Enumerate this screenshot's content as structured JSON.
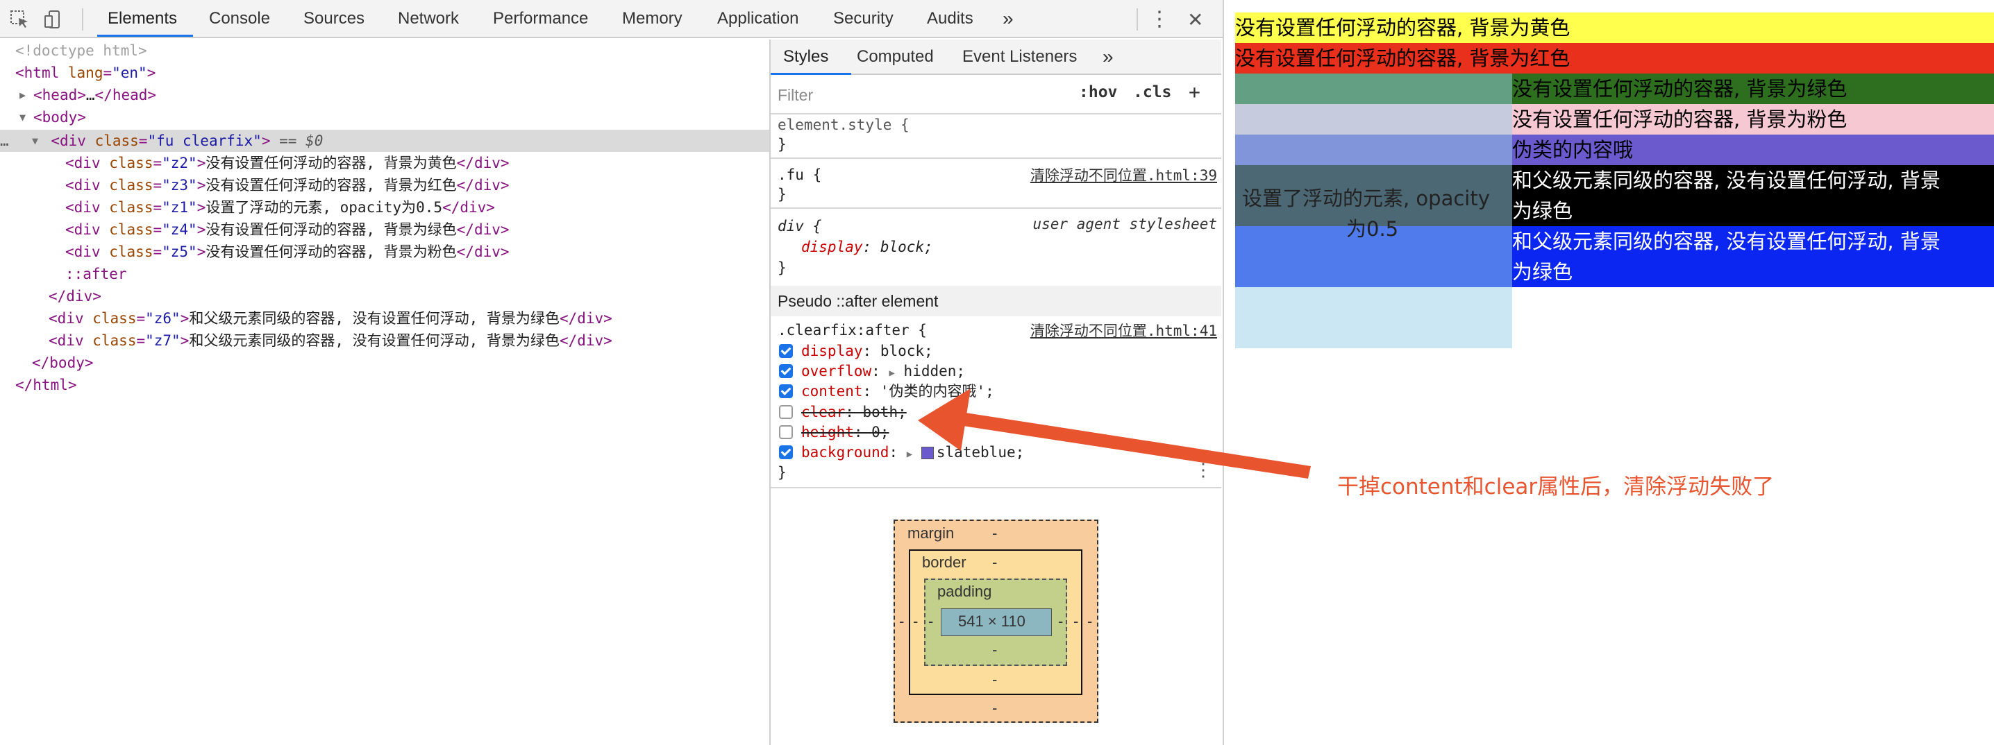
{
  "toolbar": {
    "tabs": [
      "Elements",
      "Console",
      "Sources",
      "Network",
      "Performance",
      "Memory",
      "Application",
      "Security",
      "Audits"
    ],
    "more": "»",
    "menu": "⋮",
    "close": "✕"
  },
  "dom": {
    "doctype": "<!doctype html>",
    "html_open_tag": "html",
    "html_attr": "lang",
    "html_attr_val": "\"en\"",
    "head": "head",
    "head_close": "</head>",
    "ellipsis": "…",
    "body": "body",
    "div_tag": "div",
    "class_attr": "class",
    "selected_class": "\"fu clearfix\"",
    "selected_suffix": "== $0",
    "row_dots": "…",
    "children": [
      {
        "cls": "\"z2\"",
        "text": "没有设置任何浮动的容器, 背景为黄色"
      },
      {
        "cls": "\"z3\"",
        "text": "没有设置任何浮动的容器, 背景为红色"
      },
      {
        "cls": "\"z1\"",
        "text": "设置了浮动的元素, opacity为0.5"
      },
      {
        "cls": "\"z4\"",
        "text": "没有设置任何浮动的容器, 背景为绿色"
      },
      {
        "cls": "\"z5\"",
        "text": "没有设置任何浮动的容器, 背景为粉色"
      }
    ],
    "after": "::after",
    "div_close": "</div>",
    "siblings": [
      {
        "cls": "\"z6\"",
        "text": "和父级元素同级的容器, 没有设置任何浮动, 背景为绿色"
      },
      {
        "cls": "\"z7\"",
        "text": "和父级元素同级的容器, 没有设置任何浮动, 背景为绿色"
      }
    ],
    "body_close": "</body>",
    "html_close": "</html>"
  },
  "styles": {
    "tabs": [
      "Styles",
      "Computed",
      "Event Listeners",
      "»"
    ],
    "filter_placeholder": "Filter",
    "hov": ":hov",
    "cls": ".cls",
    "plus": "+",
    "element_style": "element.style {",
    "close_brace": "}",
    "fu_selector": ".fu {",
    "fu_source": "清除浮动不同位置.html:39",
    "div_selector": "div {",
    "ua_label": "user agent stylesheet",
    "div_display_prop": "display",
    "div_display_val": "block;",
    "pseudo_header": "Pseudo ::after element",
    "clearfix_selector": ".clearfix:after {",
    "clearfix_source": "清除浮动不同位置.html:41",
    "props": [
      {
        "name": "display",
        "value": "block;",
        "checked": true
      },
      {
        "name": "overflow",
        "value": "hidden;",
        "checked": true
      },
      {
        "name": "content",
        "value": "'伪类的内容哦';",
        "checked": true
      },
      {
        "name": "clear",
        "value": "both;",
        "checked": false
      },
      {
        "name": "height",
        "value": "0;",
        "checked": false
      },
      {
        "name": "background",
        "value": "slateblue;",
        "checked": true
      }
    ],
    "kebab": "⋮"
  },
  "box_model": {
    "margin_label": "margin",
    "border_label": "border",
    "padding_label": "padding",
    "content_size": "541 × 110",
    "dash": "-"
  },
  "preview": {
    "yellow_text": "没有设置任何浮动的容器, 背景为黄色",
    "red_text": "没有设置任何浮动的容器, 背景为红色",
    "green_text": "没有设置任何浮动的容器, 背景为绿色",
    "pink_text": "没有设置任何浮动的容器, 背景为粉色",
    "pseudo_text": "伪类的内容哦",
    "float_line1": "设置了浮动的元素, opacity",
    "float_line2": "为0.5",
    "z6_line1": "和父级元素同级的容器, 没有设置任何浮动, 背景",
    "z6_line2": "为绿色",
    "z7_line1": "和父级元素同级的容器, 没有设置任何浮动, 背景",
    "z7_line2": "为绿色"
  },
  "annotation": "干掉content和clear属性后，清除浮动失败了",
  "colors": {
    "accent": "#1a73e8",
    "annotation": "#e8542e",
    "yellow": "#ffff4d",
    "red": "#e8301d",
    "green": "#2e6f1f",
    "pink": "#f6c8d2",
    "slateblue": "#6a5acd",
    "blue": "#0a26f0"
  }
}
